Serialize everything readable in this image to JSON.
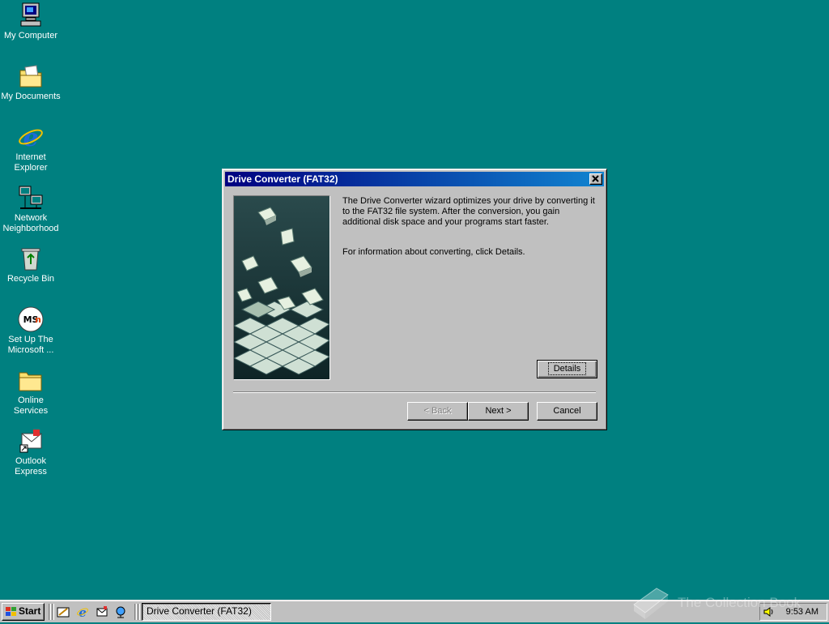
{
  "desktop": {
    "icons": [
      {
        "label_line1": "My Computer",
        "label_line2": ""
      },
      {
        "label_line1": "My Documents",
        "label_line2": ""
      },
      {
        "label_line1": "Internet",
        "label_line2": "Explorer"
      },
      {
        "label_line1": "Network",
        "label_line2": "Neighborhood"
      },
      {
        "label_line1": "Recycle Bin",
        "label_line2": ""
      },
      {
        "label_line1": "Set Up The",
        "label_line2": "Microsoft ..."
      },
      {
        "label_line1": "Online",
        "label_line2": "Services"
      },
      {
        "label_line1": "Outlook",
        "label_line2": "Express"
      }
    ],
    "background_color": "#008080"
  },
  "dialog": {
    "title": "Drive Converter (FAT32)",
    "paragraph1": "The Drive Converter wizard optimizes your drive by converting it to the FAT32 file system. After the conversion, you gain additional disk space and your programs start faster.",
    "paragraph2": "For information about converting, click Details.",
    "buttons": {
      "details": "Details",
      "back": "< Back",
      "next": "Next >",
      "cancel": "Cancel"
    }
  },
  "taskbar": {
    "start_label": "Start",
    "task_label": "Drive Converter (FAT32)",
    "clock": "9:53 AM"
  },
  "watermark": {
    "text": "The Collection Book"
  }
}
